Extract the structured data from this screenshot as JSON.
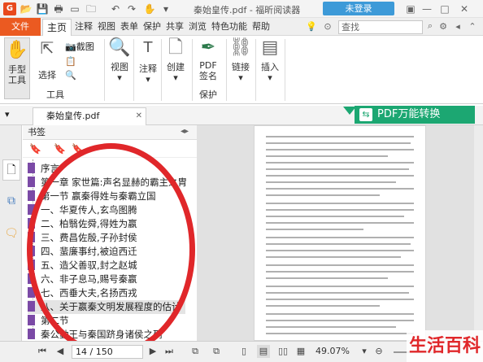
{
  "app": {
    "logo_glyph": "G",
    "title": "秦始皇传.pdf - 福昕阅读器",
    "login": "未登录"
  },
  "menu": {
    "file": "文件",
    "tabs": [
      "主页",
      "注释",
      "视图",
      "表单",
      "保护",
      "共享",
      "浏览",
      "特色功能",
      "帮助"
    ],
    "search_placeholder": "查找"
  },
  "ribbon": {
    "hand": [
      "手型",
      "工具"
    ],
    "select": "选择",
    "screenshot": "截图",
    "tools_group": "工具",
    "view": "视图",
    "annot": "注释",
    "create": "创建",
    "pdf_sign": [
      "PDF",
      "签名"
    ],
    "protect_group": "保护",
    "link": "链接",
    "insert": "插入"
  },
  "banner": {
    "text": "PDF万能转换"
  },
  "document_tab": {
    "name": "秦始皇传.pdf"
  },
  "bookmarks": {
    "header": "书签",
    "items": [
      {
        "label": "序言"
      },
      {
        "label": "第一章 家世篇:声名显赫的霸主之胄"
      },
      {
        "label": "第一节 嬴秦得姓与秦霸立国"
      },
      {
        "label": "一、华夏传人,玄鸟图腾"
      },
      {
        "label": "二、柏翳佐舜,得姓为嬴"
      },
      {
        "label": "三、费昌佐殷,子孙封侯"
      },
      {
        "label": "四、蜚廉事纣,被迫西迁"
      },
      {
        "label": "五、造父善驭,封之赵城"
      },
      {
        "label": "六、非子息马,赐号秦嬴"
      },
      {
        "label": "七、西垂大夫,名扬西戎"
      },
      {
        "label": "八、关于嬴秦文明发展程度的估计"
      },
      {
        "label": "第二节"
      },
      {
        "label": "秦公勤王与秦国跻身诸侯之列"
      }
    ]
  },
  "status": {
    "page": "14 / 150",
    "zoom": "49.07%"
  },
  "watermark": {
    "text": "生活百科"
  },
  "colors": {
    "accent": "#eb5a21",
    "login": "#3d9ad8",
    "banner": "#1ca772",
    "bookmark_flag": "#7b4aa6",
    "annotation_circle": "#e0272a"
  }
}
